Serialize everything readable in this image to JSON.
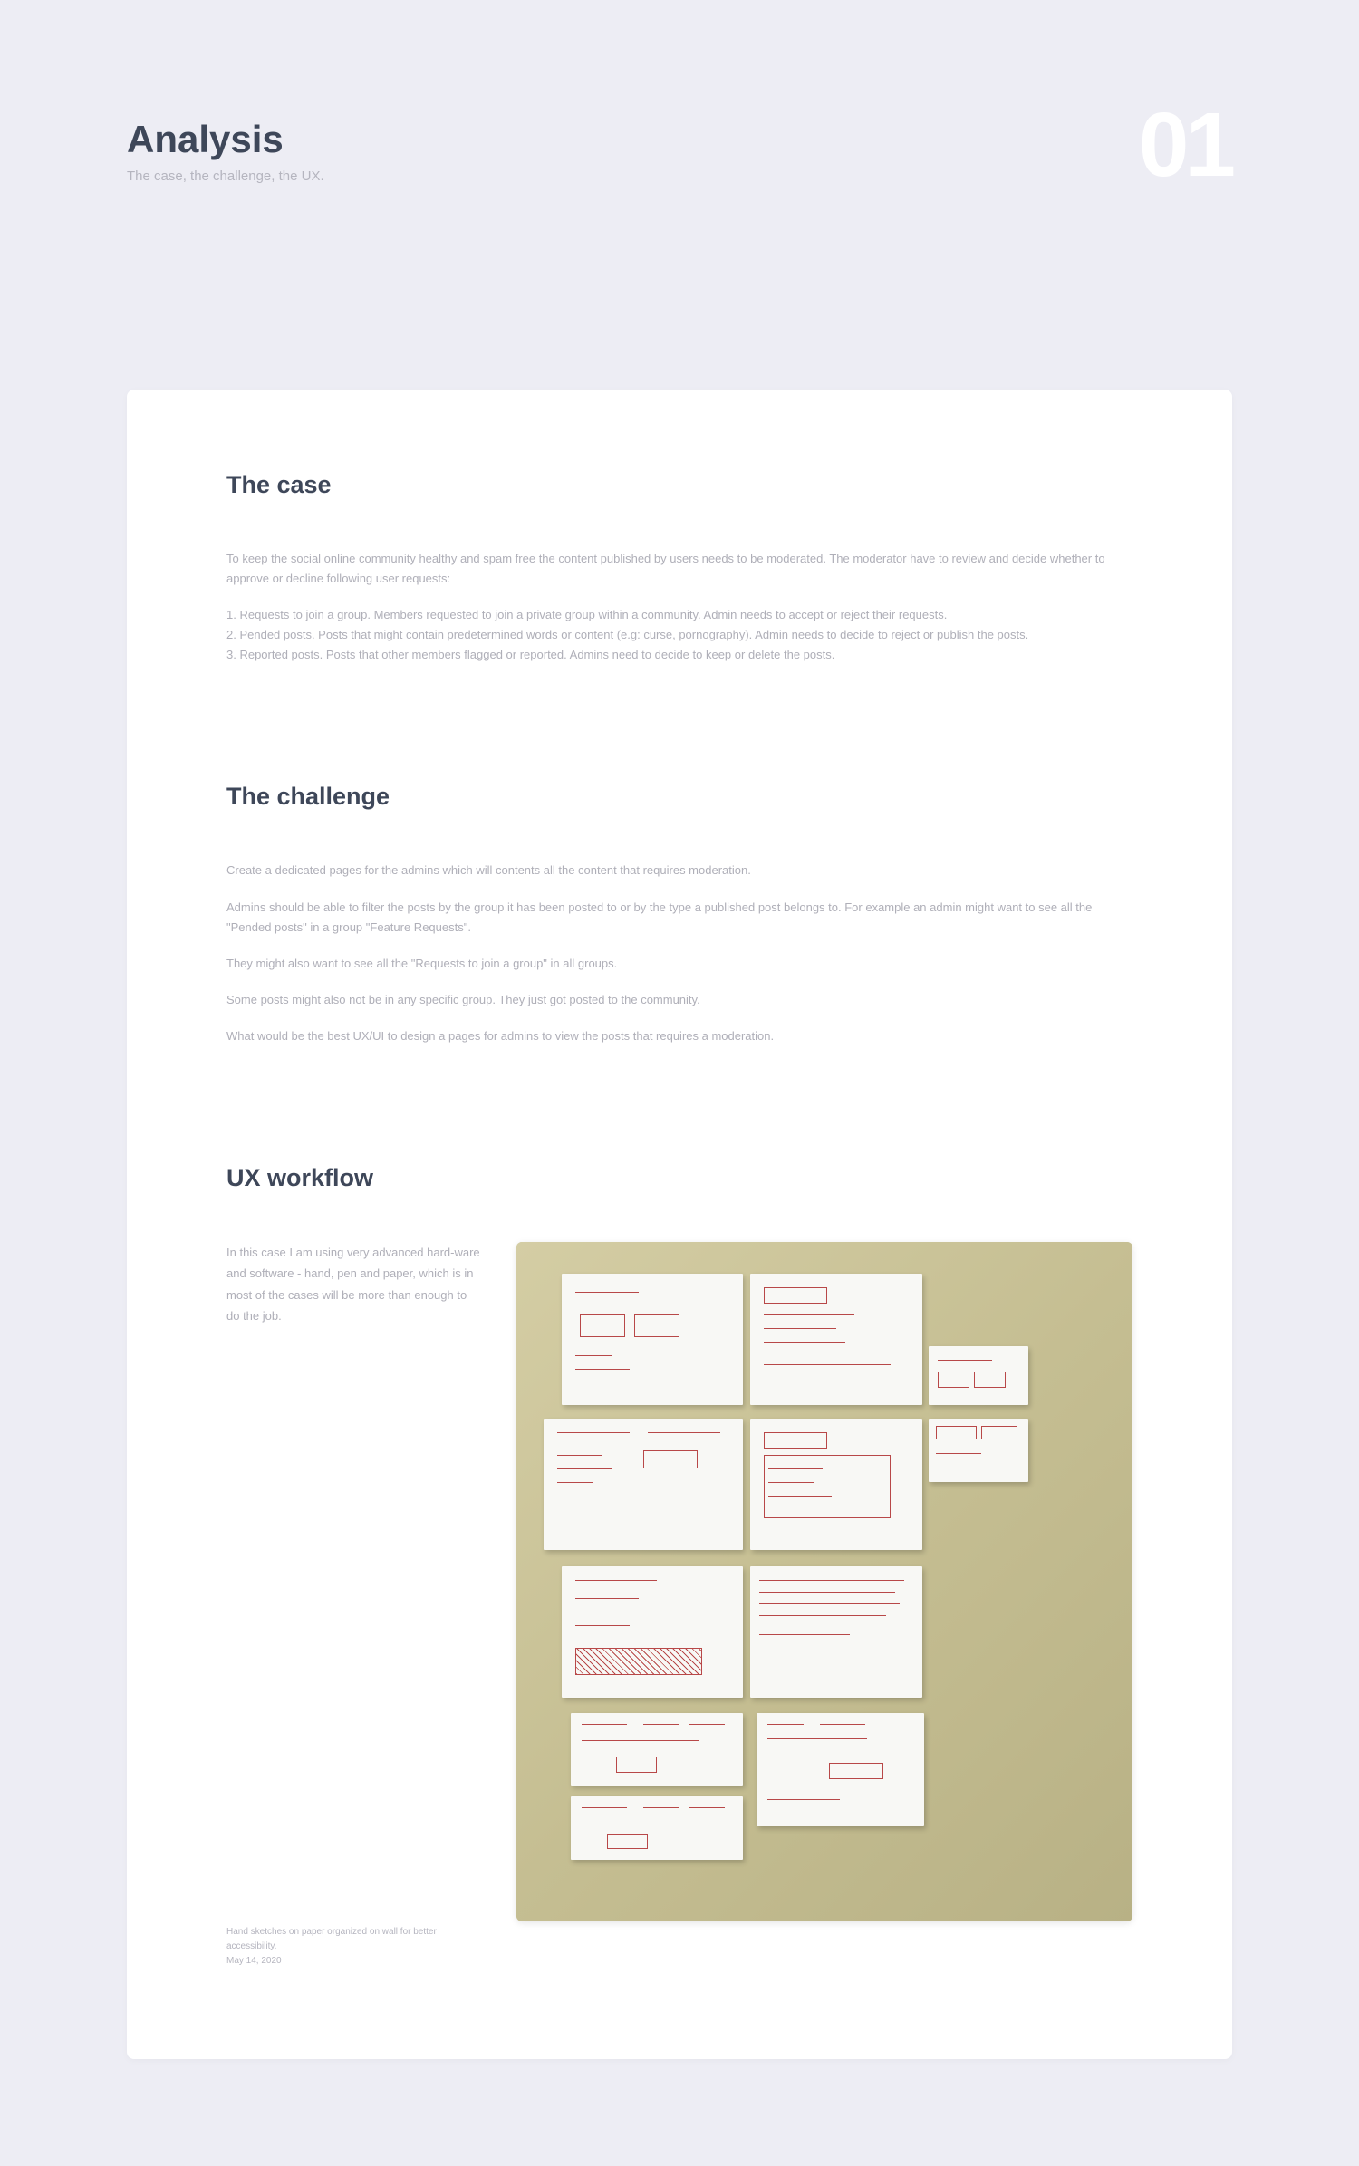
{
  "header": {
    "title": "Analysis",
    "subtitle": "The case, the challenge, the UX.",
    "number": "01"
  },
  "sections": {
    "case": {
      "heading": "The case",
      "intro": "To keep the social online community healthy and spam free the content published by users needs to be moderated. The moderator have to review and decide whether to approve or decline following user requests:",
      "items": [
        "1. Requests to join a group. Members requested to join a private group within a community. Admin needs to accept or reject their requests.",
        "2. Pended posts. Posts that might contain predetermined words or content (e.g: curse, pornography). Admin needs to decide to reject or publish the posts.",
        "3. Reported posts. Posts that other members flagged or reported. Admins need to decide to keep or delete the posts."
      ]
    },
    "challenge": {
      "heading": "The challenge",
      "paragraphs": [
        "Create a dedicated pages for the admins which will contents all the content that requires moderation.",
        "Admins should be able to filter the posts by the group it has been posted to or by the type a published post belongs to. For example an admin might want to see all the \"Pended posts\" in a group \"Feature Requests\".",
        "They might also want to see all the \"Requests to join a group\" in all groups.",
        "Some posts might also not be in any specific group. They just got posted to the community.",
        "What would be the best UX/UI to design a pages for admins to view the posts that requires a moderation."
      ]
    },
    "ux": {
      "heading": "UX workflow",
      "description": "In this case I am using very advanced hard-ware and software - hand, pen and paper, which is in most of the cases will be more than enough to do the job.",
      "caption_line1": "Hand sketches on paper organized on wall for better accessibility.",
      "caption_line2": "May 14, 2020"
    }
  },
  "sketch": {
    "alt": "Hand-drawn UX wireframe sketches on paper sheets organized on a wall"
  }
}
